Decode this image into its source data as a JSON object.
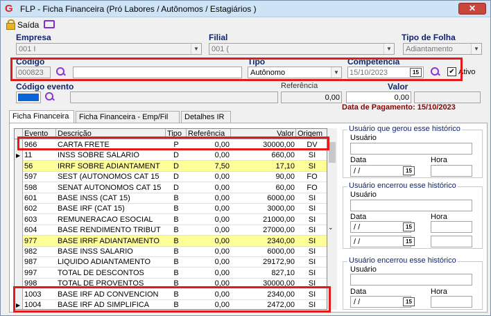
{
  "window": {
    "title": "FLP - Ficha Financeira (Pró Labores / Autônomos / Estagiários )",
    "close": "✕"
  },
  "toolbar": {
    "saida": "Saída"
  },
  "header": {
    "empresa_label": "Empresa",
    "empresa_value": "001 I",
    "filial_label": "Filial",
    "filial_value": "001 (",
    "tipo_folha_label": "Tipo de Folha",
    "tipo_folha_value": "Adiantamento",
    "codigo_label": "Código",
    "codigo_value": "000823",
    "nome_value": "",
    "tipo_label": "Tipo",
    "tipo_value": "Autônomo",
    "competencia_label": "Competência",
    "competencia_value": "15/10/2023",
    "ativo_label": "Ativo",
    "ativo_checked": "✔",
    "codigo_evento_label": "Código evento",
    "referencia_label": "Referência",
    "referencia_value": "0,00",
    "valor_label": "Valor",
    "valor_value": "0,00",
    "data_pagamento": "Data de Pagamento: 15/10/2023",
    "cal_icon": "15"
  },
  "tabs": [
    {
      "label": "Ficha Financeira"
    },
    {
      "label": "Ficha Financeira - Emp/Fil"
    },
    {
      "label": "Detalhes IR"
    }
  ],
  "grid": {
    "columns": [
      "Evento",
      "Descrição",
      "Tipo",
      "Referência",
      "Valor",
      "Origem"
    ],
    "rows": [
      {
        "evento": "966",
        "descricao": "CARTA FRETE",
        "tipo": "P",
        "referencia": "0,00",
        "valor": "30000,00",
        "origem": "DV"
      },
      {
        "evento": "11",
        "descricao": "INSS SOBRE SALARIO",
        "tipo": "D",
        "referencia": "0,00",
        "valor": "660,00",
        "origem": "SI"
      },
      {
        "evento": "56",
        "descricao": "IRRF SOBRE ADIANTAMENT",
        "tipo": "D",
        "referencia": "7,50",
        "valor": "17,10",
        "origem": "SI"
      },
      {
        "evento": "597",
        "descricao": "SEST (AUTONOMOS CAT 15",
        "tipo": "D",
        "referencia": "0,00",
        "valor": "90,00",
        "origem": "FO"
      },
      {
        "evento": "598",
        "descricao": "SENAT AUTONOMOS CAT 15",
        "tipo": "D",
        "referencia": "0,00",
        "valor": "60,00",
        "origem": "FO"
      },
      {
        "evento": "601",
        "descricao": "BASE INSS (CAT 15)",
        "tipo": "B",
        "referencia": "0,00",
        "valor": "6000,00",
        "origem": "SI"
      },
      {
        "evento": "602",
        "descricao": "BASE IRF (CAT 15)",
        "tipo": "B",
        "referencia": "0,00",
        "valor": "3000,00",
        "origem": "SI"
      },
      {
        "evento": "603",
        "descricao": "REMUNERACAO ESOCIAL",
        "tipo": "B",
        "referencia": "0,00",
        "valor": "21000,00",
        "origem": "SI"
      },
      {
        "evento": "604",
        "descricao": "BASE RENDIMENTO TRIBUT",
        "tipo": "B",
        "referencia": "0,00",
        "valor": "27000,00",
        "origem": "SI"
      },
      {
        "evento": "977",
        "descricao": "BASE IRRF ADIANTAMENTO",
        "tipo": "B",
        "referencia": "0,00",
        "valor": "2340,00",
        "origem": "SI"
      },
      {
        "evento": "982",
        "descricao": "BASE INSS SALARIO",
        "tipo": "B",
        "referencia": "0,00",
        "valor": "6000,00",
        "origem": "SI"
      },
      {
        "evento": "987",
        "descricao": "LIQUIDO ADIANTAMENTO",
        "tipo": "B",
        "referencia": "0,00",
        "valor": "29172,90",
        "origem": "SI"
      },
      {
        "evento": "997",
        "descricao": "TOTAL DE DESCONTOS",
        "tipo": "B",
        "referencia": "0,00",
        "valor": "827,10",
        "origem": "SI"
      },
      {
        "evento": "998",
        "descricao": "TOTAL DE PROVENTOS",
        "tipo": "B",
        "referencia": "0,00",
        "valor": "30000,00",
        "origem": "SI"
      },
      {
        "evento": "1003",
        "descricao": "BASE IRF AD CONVENCION",
        "tipo": "B",
        "referencia": "0,00",
        "valor": "2340,00",
        "origem": "SI"
      },
      {
        "evento": "1004",
        "descricao": "BASE IRF AD SIMPLIFICA",
        "tipo": "B",
        "referencia": "0,00",
        "valor": "2472,00",
        "origem": "SI"
      }
    ]
  },
  "side": {
    "g1_title": "Usuário que gerou esse histórico",
    "g2_title": "Usuário encerrou esse histórico",
    "g3_title": "Usuário encerrou esse histórico",
    "usuario": "Usuário",
    "data": "Data",
    "hora": "Hora",
    "date_value": "/ /"
  }
}
